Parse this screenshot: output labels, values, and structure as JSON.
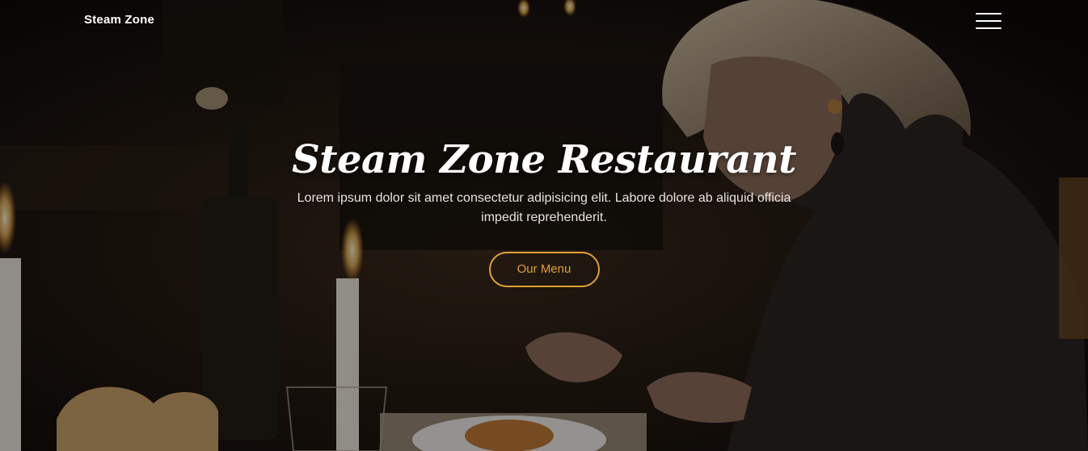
{
  "nav": {
    "brand": "Steam Zone"
  },
  "hero": {
    "title": "Steam Zone Restaurant",
    "subtitle": "Lorem ipsum dolor sit amet consectetur adipisicing elit. Labore dolore ab aliquid officia impedit reprehenderit.",
    "cta_label": "Our Menu"
  },
  "colors": {
    "accent": "#e0a132",
    "overlay": "#000000"
  },
  "icons": {
    "menu": "hamburger-icon"
  }
}
